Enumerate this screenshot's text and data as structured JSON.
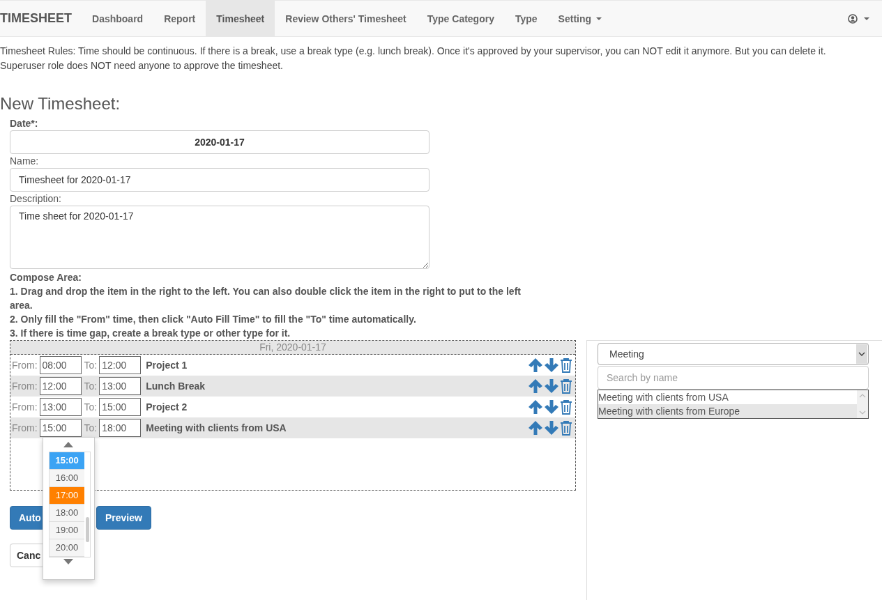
{
  "navbar": {
    "brand": "TIMESHEET",
    "items": [
      {
        "label": "Dashboard",
        "selected": false,
        "dropdown": false
      },
      {
        "label": "Report",
        "selected": false,
        "dropdown": false
      },
      {
        "label": "Timesheet",
        "selected": true,
        "dropdown": false
      },
      {
        "label": "Review Others' Timesheet",
        "selected": false,
        "dropdown": false
      },
      {
        "label": "Type Category",
        "selected": false,
        "dropdown": false
      },
      {
        "label": "Type",
        "selected": false,
        "dropdown": false
      },
      {
        "label": "Setting",
        "selected": false,
        "dropdown": true
      }
    ]
  },
  "rules": "Timesheet Rules: Time should be continuous. If there is a break, use a break type (e.g. lunch break). Once it's approved by your supervisor, you can NOT edit it anymore. But you can delete it. Superuser role does NOT need anyone to approve the timesheet.",
  "heading": "New Timesheet:",
  "form": {
    "date": {
      "label": "Date*:",
      "value": "2020-01-17"
    },
    "name": {
      "label": "Name:",
      "value": "Timesheet for 2020-01-17"
    },
    "description": {
      "label": "Description:",
      "value": "Time sheet for 2020-01-17"
    }
  },
  "compose": {
    "title": "Compose Area:",
    "instructions": [
      "1. Drag and drop the item in the right to the left. You can also double click the item in the right to put to the left area.",
      "2. Only fill the \"From\" time, then click \"Auto Fill Time\" to fill the \"To\" time automatically.",
      "3. If there is time gap, create a break type or other type for it."
    ],
    "day_header": "Fri, 2020-01-17",
    "entries": [
      {
        "from_label": "From:",
        "from": "08:00",
        "to_label": "To:",
        "to": "12:00",
        "name": "Project 1",
        "picker_open": false
      },
      {
        "from_label": "From:",
        "from": "12:00",
        "to_label": "To:",
        "to": "13:00",
        "name": "Lunch Break",
        "picker_open": false
      },
      {
        "from_label": "From:",
        "from": "13:00",
        "to_label": "To:",
        "to": "15:00",
        "name": "Project 2",
        "picker_open": false
      },
      {
        "from_label": "From:",
        "from": "15:00",
        "to_label": "To:",
        "to": "18:00",
        "name": "Meeting with clients from USA",
        "picker_open": true
      }
    ]
  },
  "time_picker": {
    "options": [
      {
        "label": "15:00",
        "selected": true,
        "hovered": false
      },
      {
        "label": "16:00",
        "selected": false,
        "hovered": false
      },
      {
        "label": "17:00",
        "selected": false,
        "hovered": true
      },
      {
        "label": "18:00",
        "selected": false,
        "hovered": false
      },
      {
        "label": "19:00",
        "selected": false,
        "hovered": false
      },
      {
        "label": "20:00",
        "selected": false,
        "hovered": false
      }
    ]
  },
  "buttons": {
    "auto_fill": "Auto",
    "preview": "Preview",
    "cancel": "Canc"
  },
  "right_panel": {
    "type_select": "Meeting",
    "search_placeholder": "Search by name",
    "items": [
      {
        "label": "Meeting with clients from USA",
        "selected": false
      },
      {
        "label": "Meeting with clients from Europe",
        "selected": true
      }
    ]
  }
}
